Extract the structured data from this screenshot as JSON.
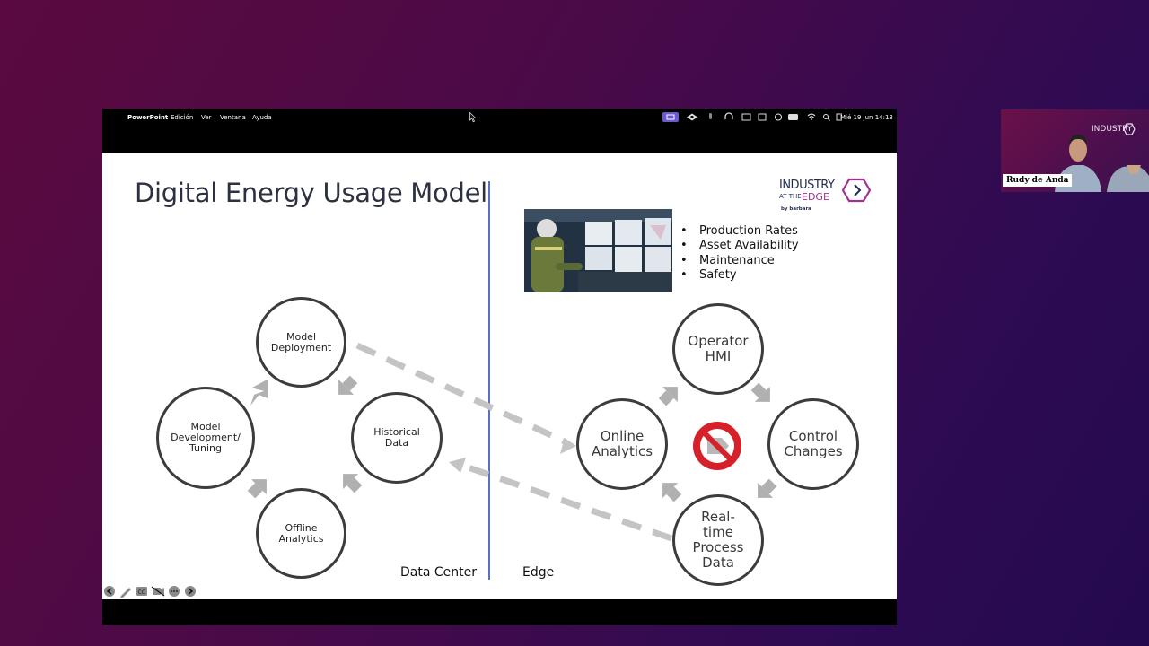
{
  "menubar": {
    "app_name": "PowerPoint",
    "items": [
      "Edición",
      "Ver",
      "Ventana",
      "Ayuda"
    ],
    "clock": "Mié 19 jun 14:13",
    "status_icons": [
      "screen-share-icon",
      "eye-icon",
      "microphone-icon",
      "headphones-icon",
      "keyboard-icon",
      "grid-icon",
      "user-icon",
      "battery-icon",
      "wifi-icon",
      "search-icon",
      "control-center-icon"
    ]
  },
  "slide": {
    "title": "Digital Energy Usage Model",
    "section_labels": {
      "left": "Data Center",
      "right": "Edge"
    },
    "bullets": [
      "Production Rates",
      "Asset Availability",
      "Maintenance",
      "Safety"
    ],
    "logo": {
      "line1": "INDUSTRY",
      "line2": "AT THE",
      "line3": "EDGE",
      "byline": "by barbara"
    },
    "data_center_cycle": {
      "model_deployment": "Model\nDeployment",
      "historical_data": "Historical\nData",
      "offline_analytics": "Offline\nAnalytics",
      "model_development": "Model\nDevelopment/\nTuning"
    },
    "edge_cycle": {
      "operator_hmi": "Operator\nHMI",
      "control_changes": "Control\nChanges",
      "realtime_data": "Real-\ntime\nProcess\nData",
      "online_analytics": "Online\nAnalytics"
    }
  },
  "webcam": {
    "name": "Rudy de Anda"
  },
  "colors": {
    "arrow": "#b0b0b0",
    "divider": "#5b6fc4",
    "no_sign": "#d6202a",
    "logo_purple": "#a2318f",
    "logo_navy": "#1f2d4f"
  }
}
